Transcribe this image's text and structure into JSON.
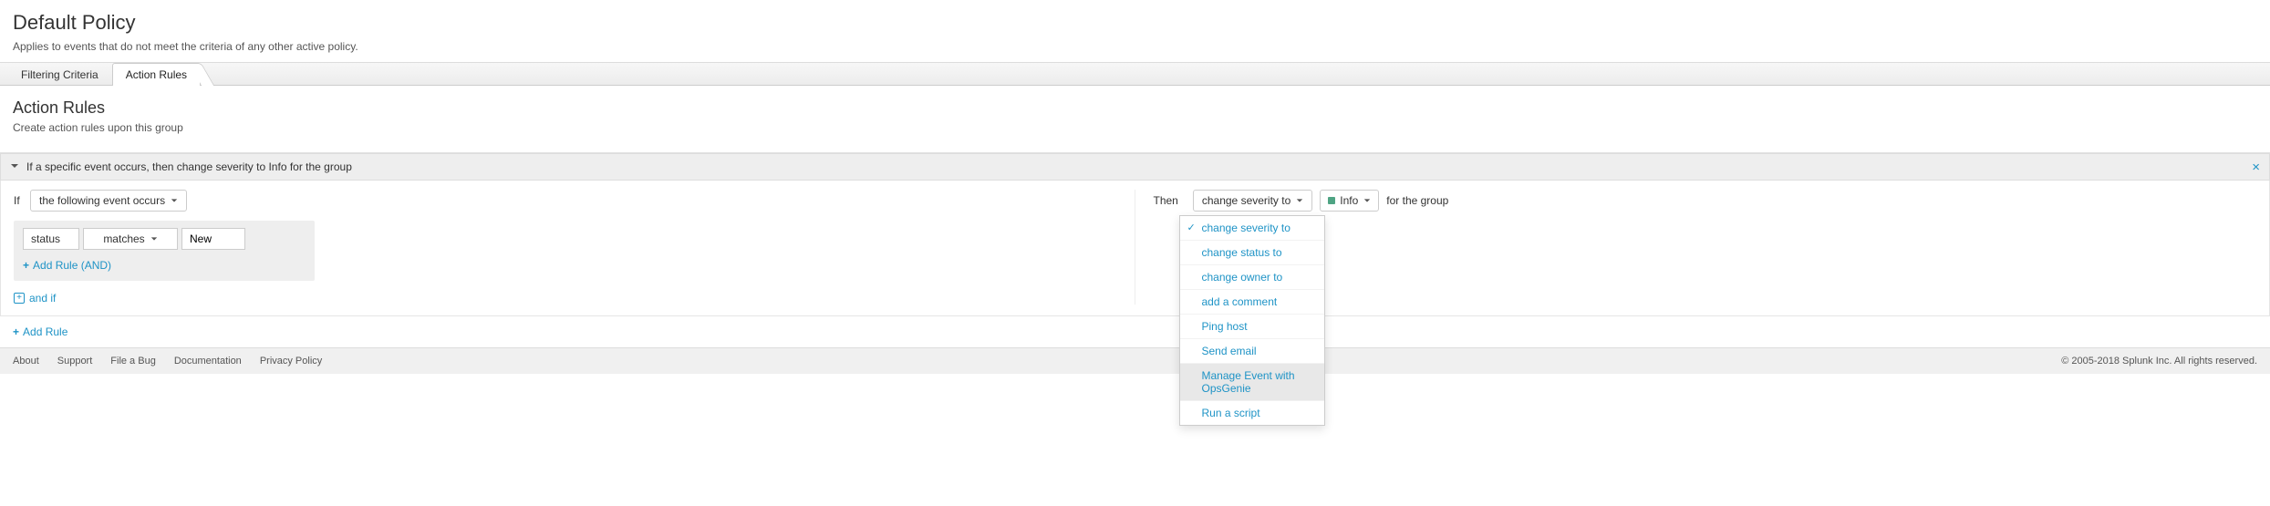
{
  "header": {
    "title": "Default Policy",
    "description": "Applies to events that do not meet the criteria of any other active policy."
  },
  "tabs": {
    "items": [
      {
        "label": "Filtering Criteria",
        "active": false
      },
      {
        "label": "Action Rules",
        "active": true
      }
    ]
  },
  "section": {
    "title": "Action Rules",
    "description": "Create action rules upon this group"
  },
  "rule": {
    "summary": "If a specific event occurs, then change severity to Info for the group",
    "if_label": "If",
    "if_dropdown": "the following event occurs",
    "condition": {
      "field": "status",
      "operator": "matches",
      "value": "New"
    },
    "add_rule_and": "Add Rule (AND)",
    "and_if": "and if",
    "then_label": "Then",
    "then_action": "change severity to",
    "then_value": "Info",
    "for_group": "for the group"
  },
  "action_dropdown": {
    "items": [
      {
        "label": "change severity to",
        "selected": true,
        "hover": false
      },
      {
        "label": "change status to",
        "selected": false,
        "hover": false
      },
      {
        "label": "change owner to",
        "selected": false,
        "hover": false
      },
      {
        "label": "add a comment",
        "selected": false,
        "hover": false
      },
      {
        "label": "Ping host",
        "selected": false,
        "hover": false
      },
      {
        "label": "Send email",
        "selected": false,
        "hover": false
      },
      {
        "label": "Manage Event with OpsGenie",
        "selected": false,
        "hover": true
      },
      {
        "label": "Run a script",
        "selected": false,
        "hover": false
      }
    ]
  },
  "add_rule": "Add Rule",
  "footer": {
    "links": [
      "About",
      "Support",
      "File a Bug",
      "Documentation",
      "Privacy Policy"
    ],
    "copyright": "© 2005-2018 Splunk Inc. All rights reserved."
  }
}
